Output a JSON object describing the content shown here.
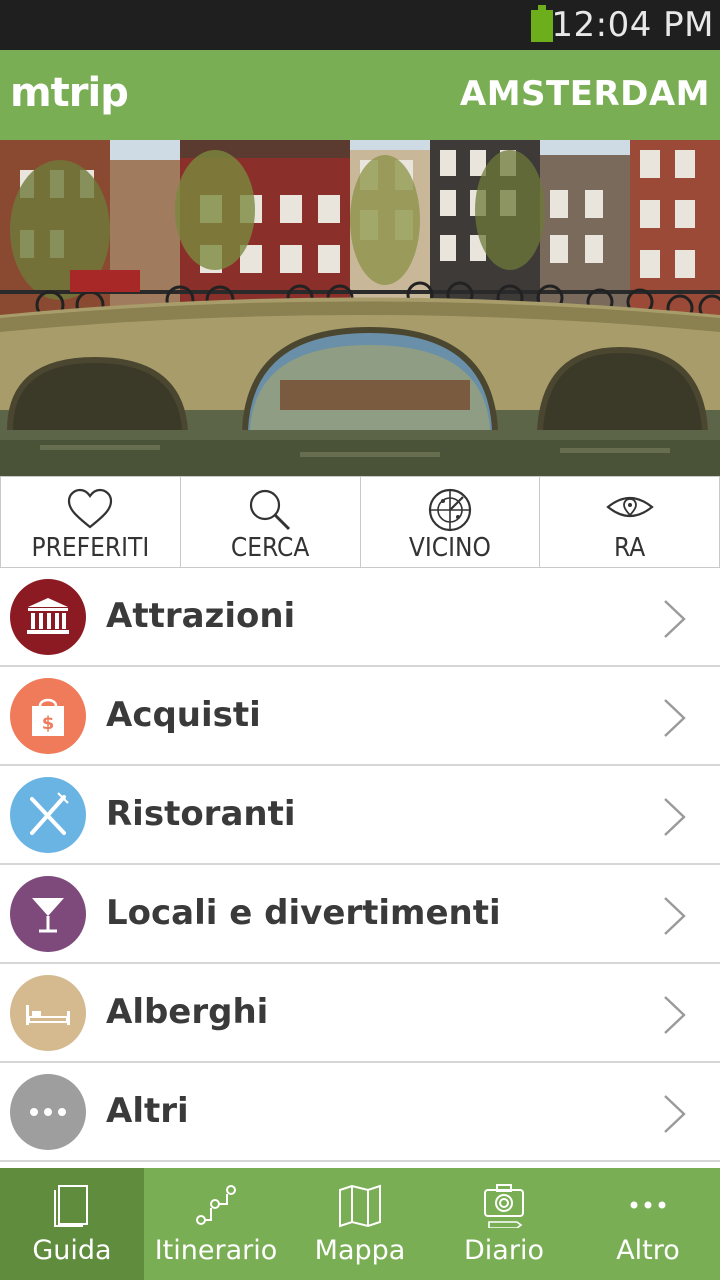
{
  "status_bar": {
    "time": "12:04 PM",
    "battery_icon": "battery-icon"
  },
  "header": {
    "logo": "mtrip",
    "city": "AMSTERDAM"
  },
  "hero": {
    "image": "amsterdam-canal-bridge-photo"
  },
  "quick_actions": [
    {
      "label": "PREFERITI",
      "icon": "heart-icon"
    },
    {
      "label": "CERCA",
      "icon": "search-icon"
    },
    {
      "label": "VICINO",
      "icon": "radar-icon"
    },
    {
      "label": "RA",
      "icon": "eye-icon"
    }
  ],
  "categories": [
    {
      "label": "Attrazioni",
      "icon": "museum-icon",
      "color": "#8c1a22"
    },
    {
      "label": "Acquisti",
      "icon": "shopping-bag-icon",
      "color": "#ef7b5a"
    },
    {
      "label": "Ristoranti",
      "icon": "fork-knife-icon",
      "color": "#6ab4e4"
    },
    {
      "label": "Locali e divertimenti",
      "icon": "cocktail-icon",
      "color": "#7e4a7c"
    },
    {
      "label": "Alberghi",
      "icon": "bed-icon",
      "color": "#d5b98f"
    },
    {
      "label": "Altri",
      "icon": "more-icon",
      "color": "#9e9e9e"
    }
  ],
  "tabs": [
    {
      "label": "Guida",
      "icon": "book-icon",
      "active": true
    },
    {
      "label": "Itinerario",
      "icon": "route-icon",
      "active": false
    },
    {
      "label": "Mappa",
      "icon": "map-icon",
      "active": false
    },
    {
      "label": "Diario",
      "icon": "camera-icon",
      "active": false
    },
    {
      "label": "Altro",
      "icon": "more-dots-icon",
      "active": false
    }
  ],
  "colors": {
    "header_green": "#7aae54",
    "active_tab_green": "#5f8c3d",
    "status_bar": "#1f1f1f",
    "battery_green": "#6cae1c"
  }
}
